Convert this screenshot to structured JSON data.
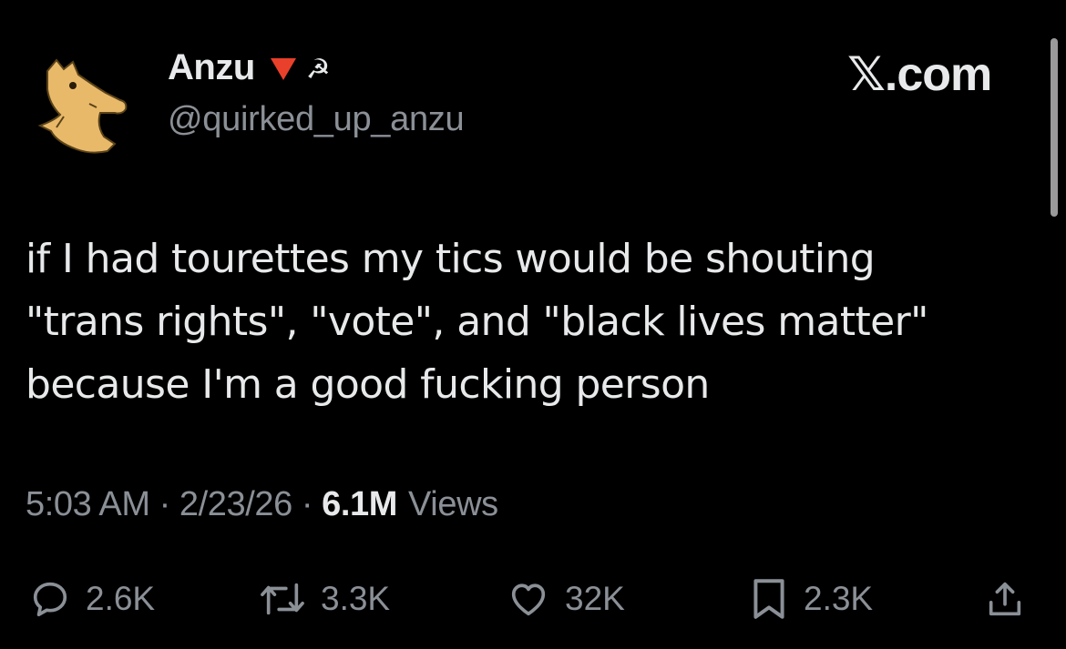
{
  "author": {
    "display_name": "Anzu",
    "badge_emoji_1": "red-triangle",
    "badge_emoji_2": "☭",
    "handle": "@quirked_up_anzu"
  },
  "brand": {
    "x_letter": "𝕏",
    "suffix": ".com"
  },
  "tweet": {
    "lines": [
      "if I had tourettes my tics would be shouting",
      "\"trans rights\", \"vote\", and \"black lives matter\"",
      "because I'm a good fucking person"
    ]
  },
  "meta": {
    "time": "5:03 AM",
    "separator": "·",
    "date": "2/23/26",
    "views_count": "6.1M",
    "views_label": "Views"
  },
  "actions": {
    "replies": "2.6K",
    "reposts": "3.3K",
    "likes": "32K",
    "bookmarks": "2.3K"
  },
  "colors": {
    "background": "#000000",
    "text": "#e7e9ea",
    "secondary": "#8b9097",
    "avatar_fill": "#e9b96a",
    "badge_red": "#e8402a"
  }
}
